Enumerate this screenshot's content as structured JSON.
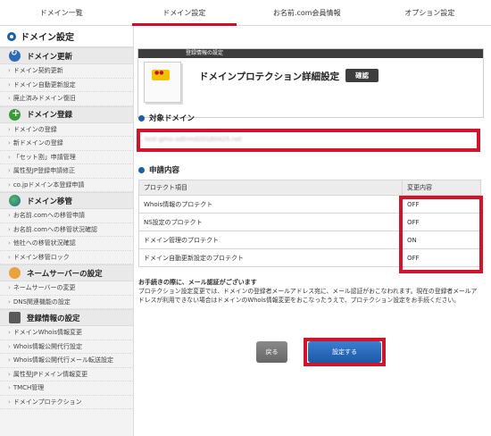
{
  "topnav": {
    "tabs": [
      {
        "label": "ドメイン一覧"
      },
      {
        "label": "ドメイン設定"
      },
      {
        "label": "お名前.com会員情報"
      },
      {
        "label": "オプション設定"
      }
    ],
    "active_tab": "ドメイン設定"
  },
  "sidebar": {
    "title": "ドメイン設定",
    "sections": [
      {
        "icon": "refresh-icon",
        "title": "ドメイン更新",
        "items": [
          "ドメイン契約更新",
          "ドメイン自動更新設定",
          "廃止済みドメイン復旧"
        ]
      },
      {
        "icon": "plus-icon",
        "title": "ドメイン登録",
        "items": [
          "ドメインの登録",
          "新ドメインの登録",
          "「セット割」申請管理",
          "属性型JP登録申請修正",
          "co.jpドメイン本登録申請"
        ]
      },
      {
        "icon": "globe-icon",
        "title": "ドメイン移管",
        "items": [
          "お名前.comへの移管申請",
          "お名前.comへの移管状況確認",
          "他社への移管状況確認",
          "ドメイン移管ロック"
        ]
      },
      {
        "icon": "person-icon",
        "title": "ネームサーバーの設定",
        "items": [
          "ネームサーバーの変更",
          "DNS関連機能の設定"
        ]
      },
      {
        "icon": "grid-icon",
        "title": "登録情報の設定",
        "items": [
          "ドメインWhois情報変更",
          "Whois情報公開代行設定",
          "Whois情報公開代行メール転送設定",
          "属性型JPドメイン情報変更",
          "TMCH管理",
          "ドメインプロテクション"
        ]
      }
    ]
  },
  "header_box": {
    "bar_label": "登録情報の設定",
    "title": "ドメインプロテクション詳細設定",
    "badge": "確認"
  },
  "target_domain": {
    "label": "対象ドメイン",
    "value": "test-gmo-adtrmd20180425.net"
  },
  "application": {
    "label": "申請内容",
    "columns": [
      "プロテクト項目",
      "変更内容"
    ],
    "rows": [
      {
        "item": "Whois情報のプロテクト",
        "value": "OFF"
      },
      {
        "item": "NS設定のプロテクト",
        "value": "OFF"
      },
      {
        "item": "ドメイン管理のプロテクト",
        "value": "ON"
      },
      {
        "item": "ドメイン自動更新設定のプロテクト",
        "value": "OFF"
      }
    ]
  },
  "notice": {
    "heading": "お手続きの際に、メール認証がございます",
    "body": "プロテクション設定変更では、ドメインの登録者メールアドレス宛に、メール認証がおこなわれます。現在の登録者メールアドレスが利用できない場合はドメインのWhois情報変更をおこなったうえで、プロテクション設定をお手続ください。"
  },
  "buttons": {
    "back": "戻る",
    "submit": "設定する"
  },
  "colors": {
    "highlight_red": "#d0142b",
    "accent_blue": "#1b5fa8",
    "active_tab_red": "#c8102e"
  }
}
